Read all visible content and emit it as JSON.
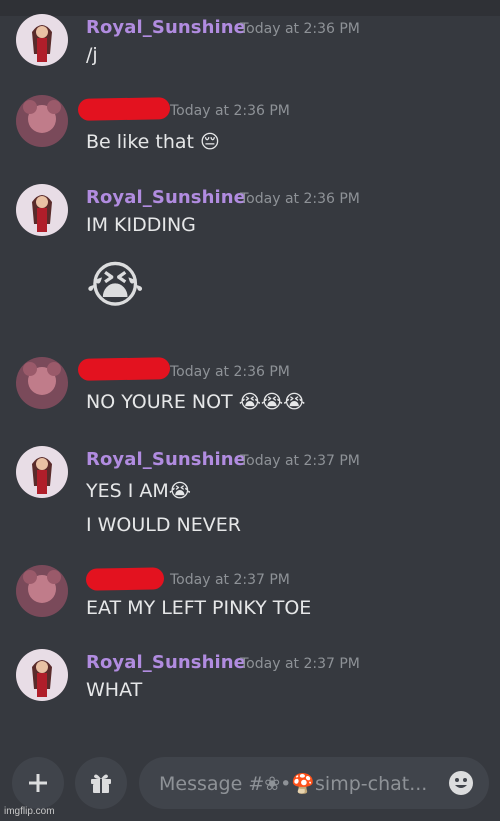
{
  "messages": [
    {
      "username": "Royal_Sunshine",
      "timestamp": "Today at 2:36 PM",
      "lines": [
        "/j"
      ],
      "redacted": false
    },
    {
      "username": "",
      "timestamp": "Today at 2:36 PM",
      "lines": [
        "Be like that 😔"
      ],
      "redacted": true
    },
    {
      "username": "Royal_Sunshine",
      "timestamp": "Today at 2:36 PM",
      "lines": [
        "IM KIDDING"
      ],
      "big_emoji": "😭",
      "redacted": false
    },
    {
      "username": "",
      "timestamp": "Today at 2:36 PM",
      "lines": [
        "NO YOURE NOT 😭😭😭"
      ],
      "redacted": true
    },
    {
      "username": "Royal_Sunshine",
      "timestamp": "Today at 2:37 PM",
      "lines": [
        "YES I AM😭",
        "I WOULD NEVER"
      ],
      "redacted": false
    },
    {
      "username": "",
      "timestamp": "Today at 2:37 PM",
      "lines": [
        "EAT MY LEFT PINKY TOE"
      ],
      "redacted": true
    },
    {
      "username": "Royal_Sunshine",
      "timestamp": "Today at 2:37 PM",
      "lines": [
        "WHAT"
      ],
      "redacted": false
    }
  ],
  "composer": {
    "placeholder": "Message #❀•🍄simp-chat...",
    "add_icon": "plus-icon",
    "gift_icon": "gift-icon",
    "emoji_icon": "smiley-icon"
  },
  "watermark": "imgflip.com",
  "colors": {
    "background": "#36393f",
    "username": "#b18ce0",
    "timestamp": "#8e9297",
    "redaction": "#e3121f",
    "input": "#40444b"
  }
}
